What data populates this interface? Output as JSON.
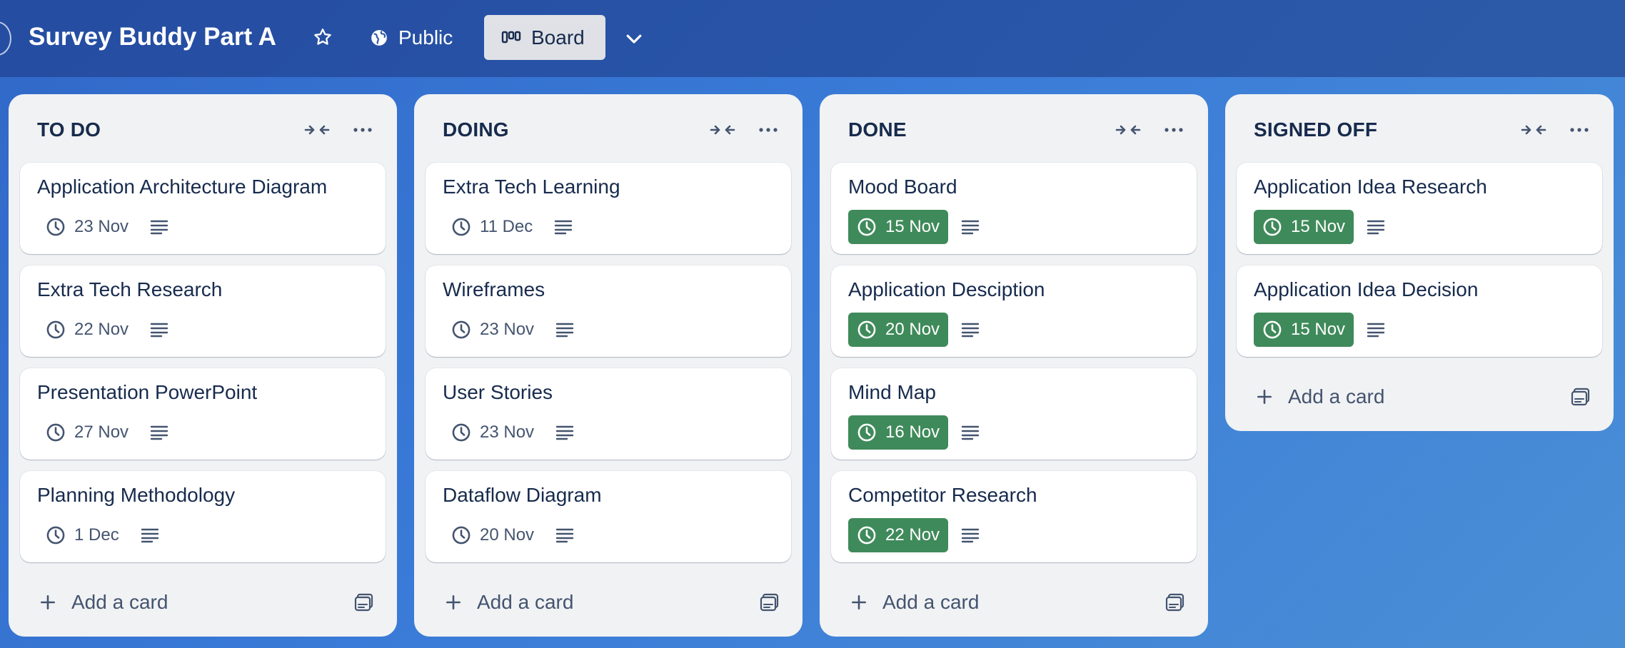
{
  "header": {
    "board_title": "Survey Buddy Part A",
    "visibility_label": "Public",
    "view_label": "Board"
  },
  "colors": {
    "complete_badge": "#3f8a5a",
    "list_background": "#f1f2f4",
    "text_primary": "#172b4d"
  },
  "add_card_label": "Add a card",
  "lists": [
    {
      "title": "TO DO",
      "cards": [
        {
          "title": "Application Architecture Diagram",
          "due": "23 Nov",
          "complete": false
        },
        {
          "title": "Extra Tech Research",
          "due": "22 Nov",
          "complete": false
        },
        {
          "title": "Presentation PowerPoint",
          "due": "27 Nov",
          "complete": false
        },
        {
          "title": "Planning Methodology",
          "due": "1 Dec",
          "complete": false
        }
      ]
    },
    {
      "title": "DOING",
      "cards": [
        {
          "title": "Extra Tech Learning",
          "due": "11 Dec",
          "complete": false
        },
        {
          "title": "Wireframes",
          "due": "23 Nov",
          "complete": false
        },
        {
          "title": "User Stories",
          "due": "23 Nov",
          "complete": false
        },
        {
          "title": "Dataflow Diagram",
          "due": "20 Nov",
          "complete": false
        }
      ]
    },
    {
      "title": "DONE",
      "cards": [
        {
          "title": "Mood Board",
          "due": "15 Nov",
          "complete": true
        },
        {
          "title": "Application Desciption",
          "due": "20 Nov",
          "complete": true
        },
        {
          "title": "Mind Map",
          "due": "16 Nov",
          "complete": true
        },
        {
          "title": "Competitor Research",
          "due": "22 Nov",
          "complete": true
        }
      ]
    },
    {
      "title": "SIGNED OFF",
      "cards": [
        {
          "title": "Application Idea Research",
          "due": "15 Nov",
          "complete": true
        },
        {
          "title": "Application Idea Decision",
          "due": "15 Nov",
          "complete": true
        }
      ]
    }
  ]
}
